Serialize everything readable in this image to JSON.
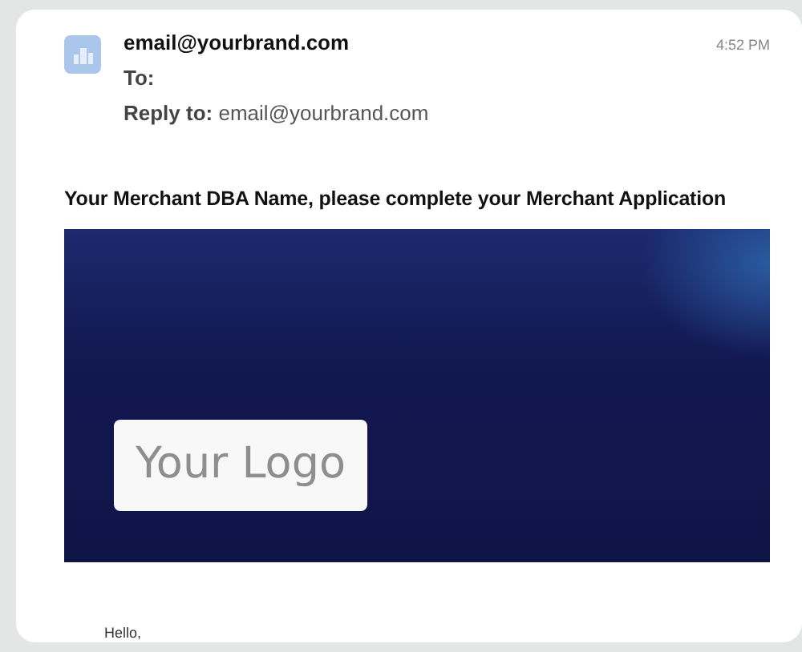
{
  "email": {
    "sender": "email@yourbrand.com",
    "time": "4:52 PM",
    "to_label": "To:",
    "reply_to_label": "Reply to:",
    "reply_to": "email@yourbrand.com"
  },
  "subject": "Your Merchant DBA Name, please complete your Merchant Application",
  "banner": {
    "logo_text": "Your Logo"
  },
  "body": [
    "Hello,"
  ]
}
